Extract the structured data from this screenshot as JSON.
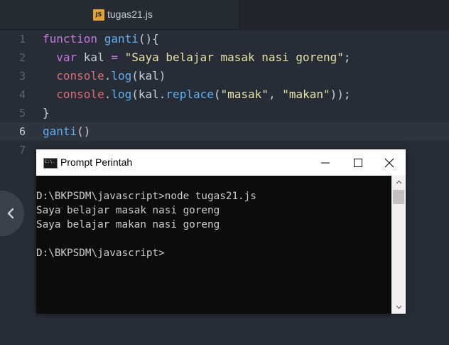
{
  "editor": {
    "tab": {
      "icon_text": "JS",
      "label": "tugas21.js"
    },
    "active_line": 6,
    "lines": [
      {
        "num": "1",
        "tokens": [
          {
            "t": "function ",
            "c": "kw"
          },
          {
            "t": "ganti",
            "c": "fn"
          },
          {
            "t": "(){",
            "c": "pun"
          }
        ]
      },
      {
        "num": "2",
        "tokens": [
          {
            "t": "  var ",
            "c": "kw"
          },
          {
            "t": "kal ",
            "c": "pun"
          },
          {
            "t": "= ",
            "c": "op"
          },
          {
            "t": "\"Saya belajar masak nasi goreng\"",
            "c": "str"
          },
          {
            "t": ";",
            "c": "pun"
          }
        ]
      },
      {
        "num": "3",
        "tokens": [
          {
            "t": "  console",
            "c": "obj"
          },
          {
            "t": ".",
            "c": "pun"
          },
          {
            "t": "log",
            "c": "fn"
          },
          {
            "t": "(kal)",
            "c": "pun"
          }
        ]
      },
      {
        "num": "4",
        "tokens": [
          {
            "t": "  console",
            "c": "obj"
          },
          {
            "t": ".",
            "c": "pun"
          },
          {
            "t": "log",
            "c": "fn"
          },
          {
            "t": "(kal.",
            "c": "pun"
          },
          {
            "t": "replace",
            "c": "fn"
          },
          {
            "t": "(",
            "c": "pun"
          },
          {
            "t": "\"masak\"",
            "c": "str"
          },
          {
            "t": ", ",
            "c": "pun"
          },
          {
            "t": "\"makan\"",
            "c": "str"
          },
          {
            "t": "));",
            "c": "pun"
          }
        ]
      },
      {
        "num": "5",
        "tokens": [
          {
            "t": "}",
            "c": "pun"
          }
        ]
      },
      {
        "num": "6",
        "tokens": [
          {
            "t": "ganti",
            "c": "fn"
          },
          {
            "t": "()",
            "c": "pun"
          }
        ]
      },
      {
        "num": "7",
        "tokens": []
      }
    ]
  },
  "console": {
    "title": "Prompt Perintah",
    "icon_text": "C:\\.",
    "lines": [
      "",
      "D:\\BKPSDM\\javascript>node tugas21.js",
      "Saya belajar masak nasi goreng",
      "Saya belajar makan nasi goreng",
      "",
      "D:\\BKPSDM\\javascript>"
    ]
  },
  "icons": {
    "sidebar_toggle": "chevron-left-icon",
    "minimize": "minimize-icon",
    "maximize": "maximize-icon",
    "close": "close-icon",
    "scroll_up": "chevron-up-icon",
    "scroll_down": "chevron-down-icon"
  },
  "colors": {
    "editor_bg": "#272d36",
    "keyword": "#c678dd",
    "function": "#61afef",
    "string": "#e5e5a6",
    "object": "#e06c75",
    "console_bg": "#0c0c0c",
    "console_text": "#cccccc"
  }
}
